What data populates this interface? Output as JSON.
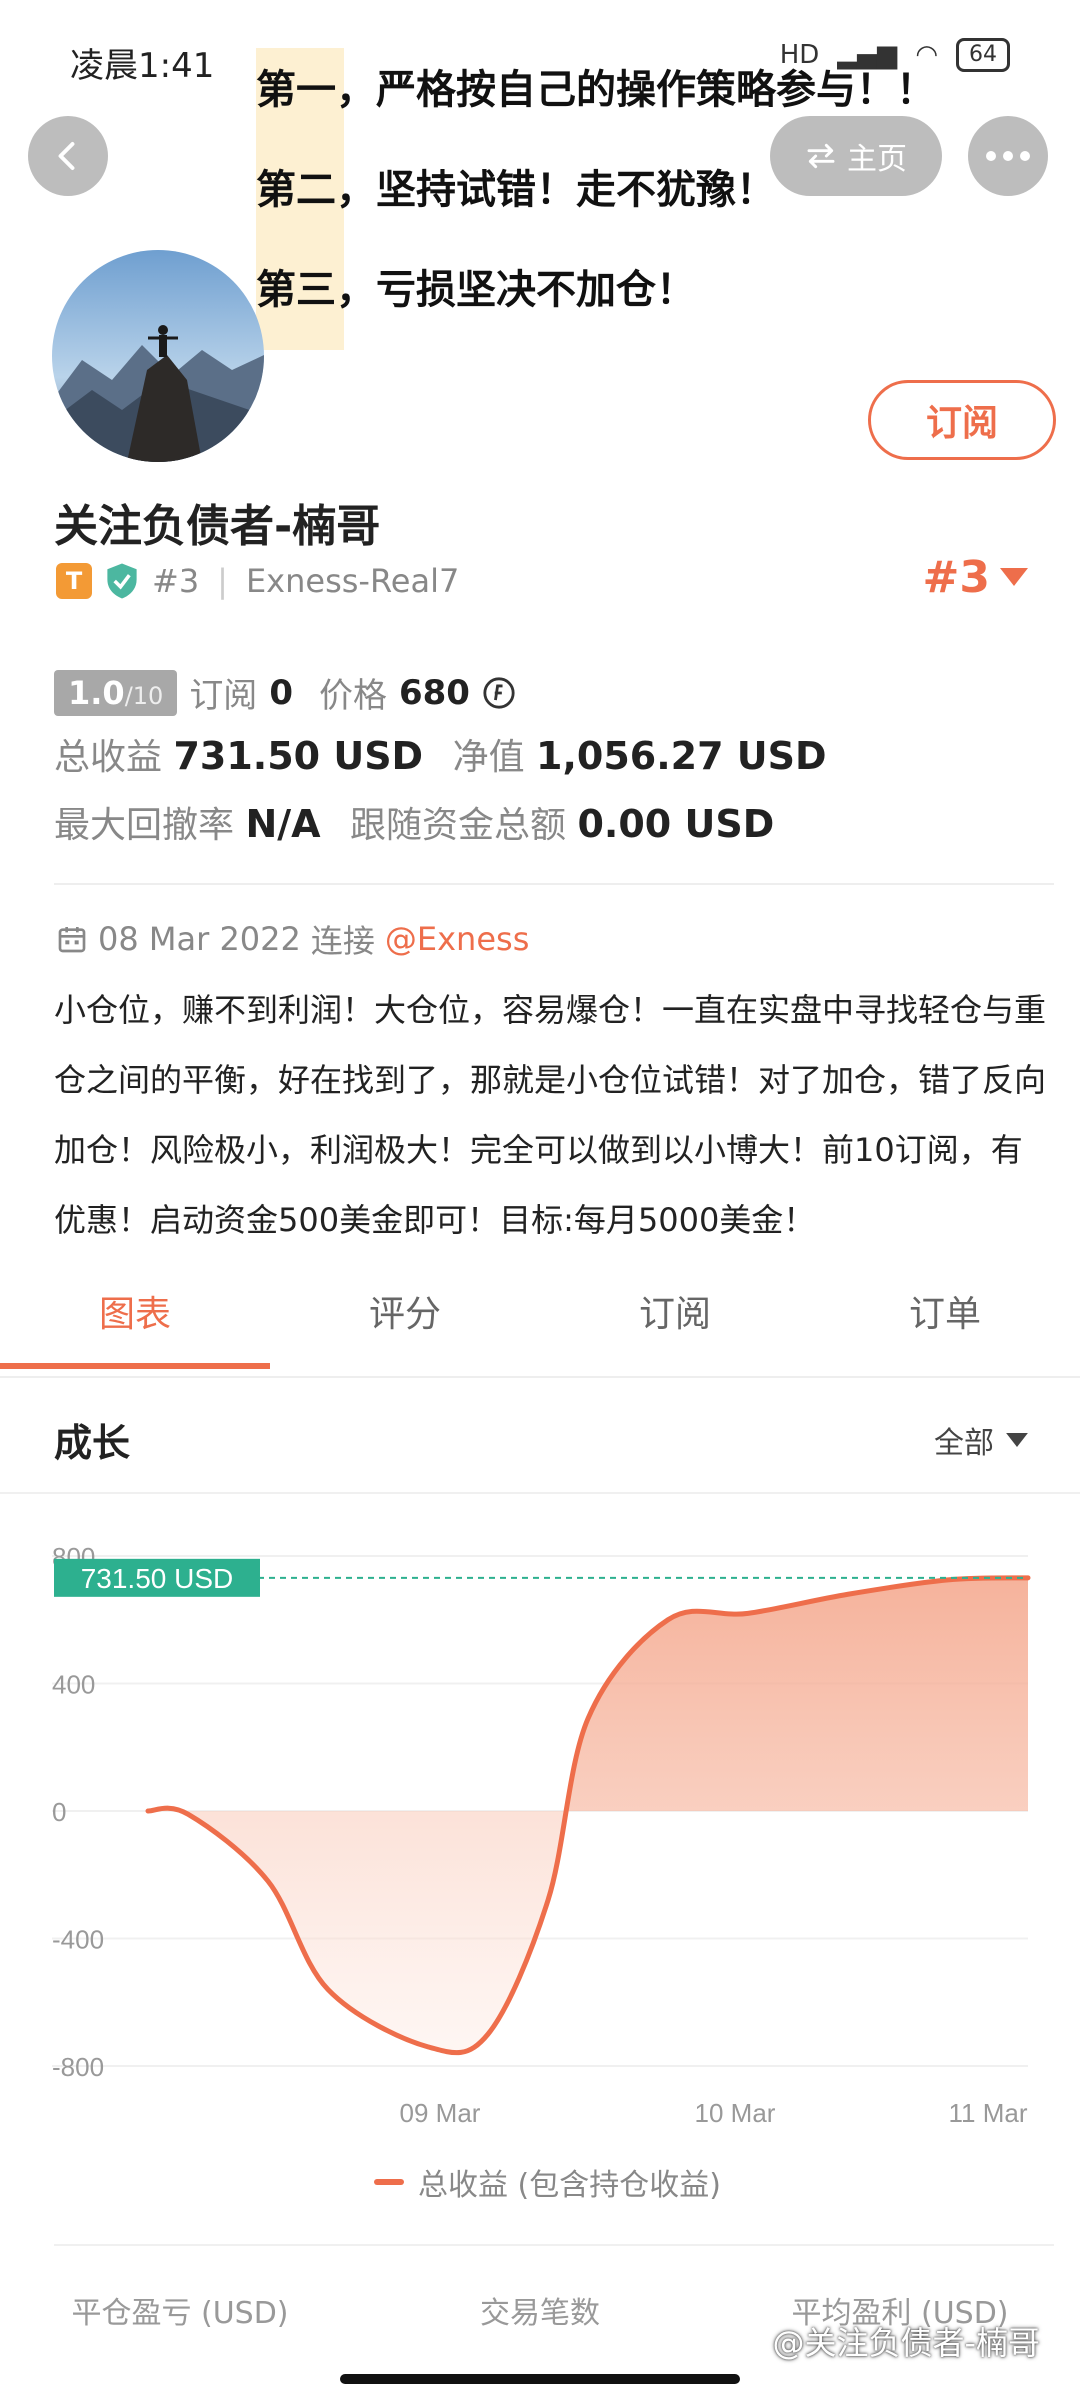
{
  "status_bar": {
    "time": "凌晨1:41",
    "battery": "64",
    "network": "HD"
  },
  "header": {
    "home_label": "主页"
  },
  "overlay_text": {
    "line1": "第一，严格按自己的操作策略参与！！",
    "line2": "第二，坚持试错！走不犹豫！",
    "line3": "第三，亏损坚决不加仓！"
  },
  "profile": {
    "name": "关注负债者-楠哥",
    "badge_letter": "T",
    "rank": "#3",
    "broker": "Exness-Real7",
    "subscribe_label": "订阅",
    "rank_right": "#3"
  },
  "stats": {
    "score": "1.0",
    "score_max": "/10",
    "subscriptions_label": "订阅",
    "subscriptions": "0",
    "price_label": "价格",
    "price": "680",
    "total_profit_label": "总收益",
    "total_profit": "731.50 USD",
    "equity_label": "净值",
    "equity": "1,056.27 USD",
    "max_drawdown_label": "最大回撤率",
    "max_drawdown": "N/A",
    "follow_funds_label": "跟随资金总额",
    "follow_funds": "0.00 USD"
  },
  "connection": {
    "date": "08 Mar 2022",
    "text": "连接",
    "broker": "@Exness"
  },
  "description": "小仓位，赚不到利润！大仓位，容易爆仓！一直在实盘中寻找轻仓与重仓之间的平衡，好在找到了，那就是小仓位试错！对了加仓，错了反向加仓！风险极小，利润极大！完全可以做到以小博大！前10订阅，有优惠！启动资金500美金即可！目标:每月5000美金！",
  "tabs": [
    "图表",
    "评分",
    "订阅",
    "订单"
  ],
  "section": {
    "title": "成长",
    "range": "全部"
  },
  "chart_data": {
    "type": "area",
    "y_ticks": [
      "800",
      "400",
      "0",
      "-400",
      "-800"
    ],
    "ylim": [
      -800,
      800
    ],
    "x_ticks": [
      "09 Mar",
      "10 Mar",
      "11 Mar"
    ],
    "current_label": "731.50 USD",
    "current_value": 731.5,
    "series": [
      {
        "name": "总收益 (包含持仓收益)",
        "x": [
          0,
          0.1,
          0.3,
          0.45,
          0.7,
          0.85,
          1.0,
          1.1,
          1.3,
          1.5,
          1.75,
          2.0,
          2.2
        ],
        "values": [
          0,
          -10,
          -220,
          -560,
          -740,
          -700,
          -280,
          290,
          600,
          620,
          680,
          725,
          731.5
        ]
      }
    ],
    "line_color": "#ee6e4b",
    "label_color": "#2db08f"
  },
  "footer": {
    "cols": [
      "平仓盈亏 (USD)",
      "交易笔数",
      "平均盈利 (USD)"
    ],
    "watermark": "@关注负债者-楠哥"
  }
}
